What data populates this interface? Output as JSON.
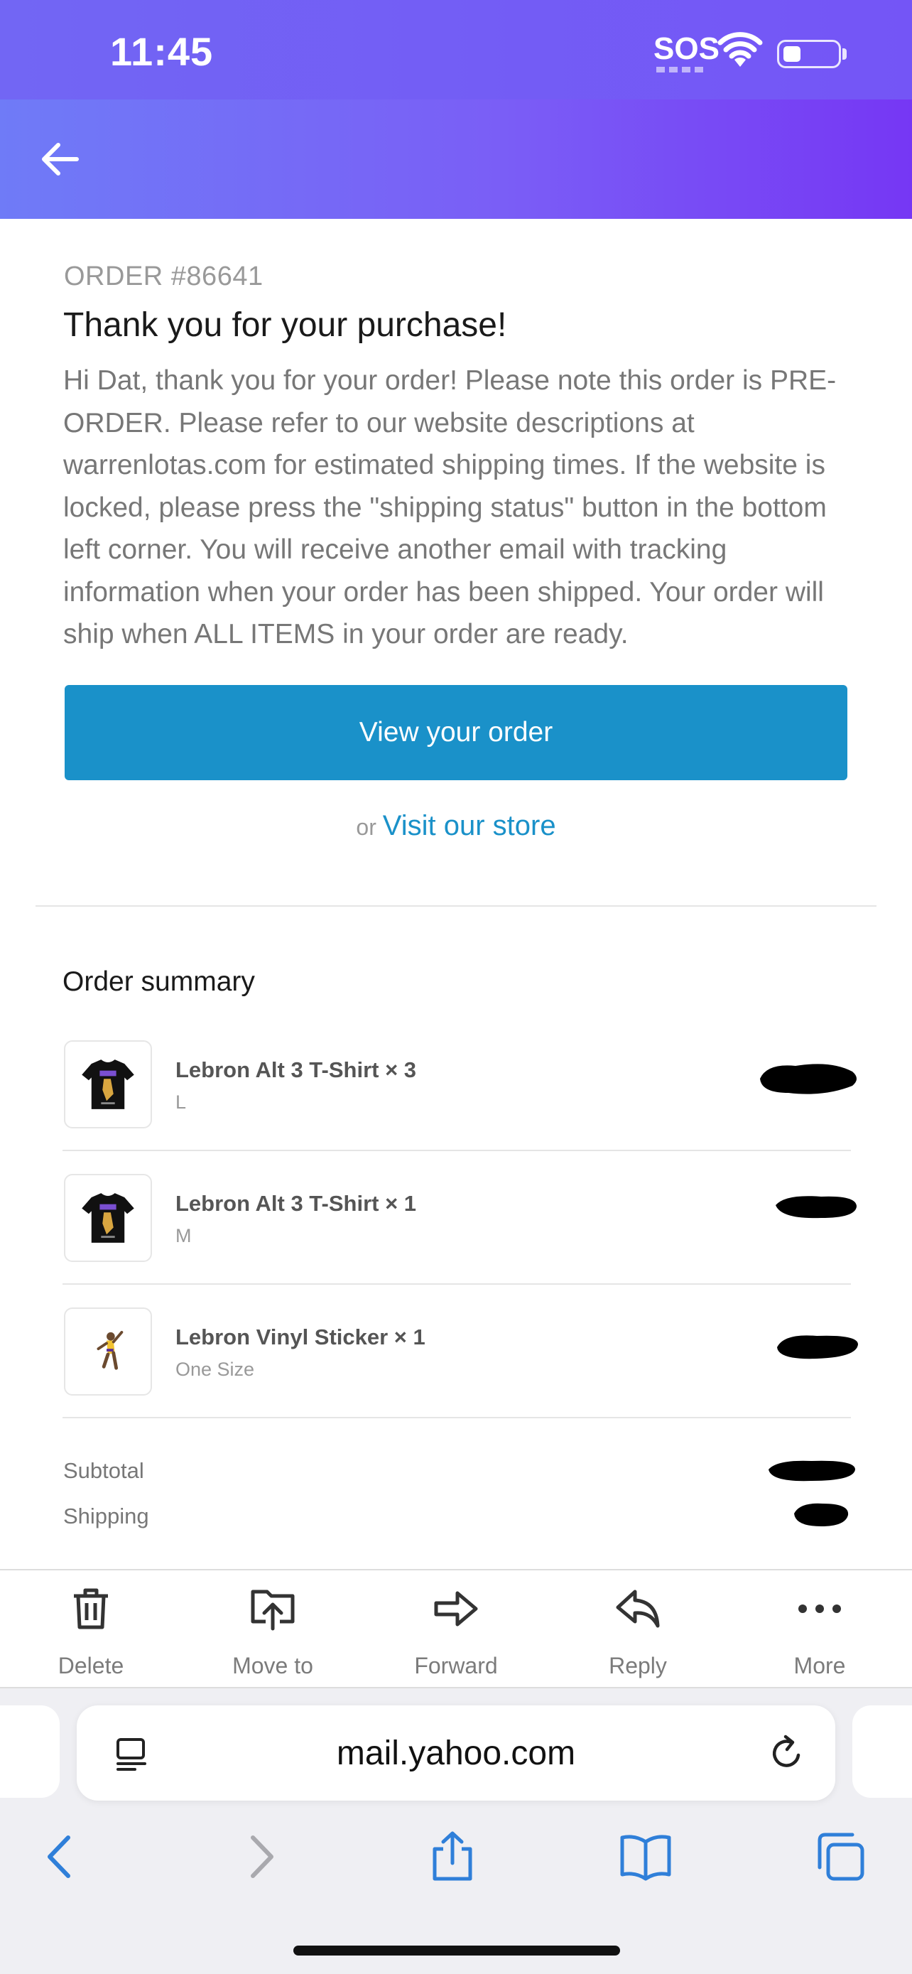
{
  "status_bar": {
    "time": "11:45",
    "sos": "SOS"
  },
  "email": {
    "order_number": "ORDER #86641",
    "heading": "Thank you for your purchase!",
    "body": "Hi Dat, thank you for your order! Please note this order is PRE-ORDER. Please refer to our website descriptions at warrenlotas.com for estimated shipping times. If the website is locked, please press the \"shipping status\" button in the bottom left corner. You will receive another email with tracking information when your order has been shipped. Your order will ship when ALL ITEMS in your order are ready.",
    "view_order_label": "View your order",
    "or_label": "or",
    "visit_store_label": "Visit our store",
    "accent_color": "#1a91c9"
  },
  "order_summary": {
    "title": "Order summary",
    "items": [
      {
        "name": "Lebron Alt 3 T-Shirt × 3",
        "variant": "L",
        "thumbnail": "black-tshirt-lebron-graphic"
      },
      {
        "name": "Lebron Alt 3 T-Shirt × 1",
        "variant": "M",
        "thumbnail": "black-tshirt-lebron-graphic"
      },
      {
        "name": "Lebron Vinyl Sticker × 1",
        "variant": "One Size",
        "thumbnail": "lebron-dunk-sticker"
      }
    ],
    "subtotal_label": "Subtotal",
    "shipping_label": "Shipping"
  },
  "toolbar": {
    "delete_label": "Delete",
    "move_label": "Move to",
    "forward_label": "Forward",
    "reply_label": "Reply",
    "more_label": "More"
  },
  "browser": {
    "url": "mail.yahoo.com"
  },
  "colors": {
    "header_gradient_start": "#6f7bf7",
    "header_gradient_end": "#7637f4",
    "ios_blue": "#2f7fd9"
  }
}
